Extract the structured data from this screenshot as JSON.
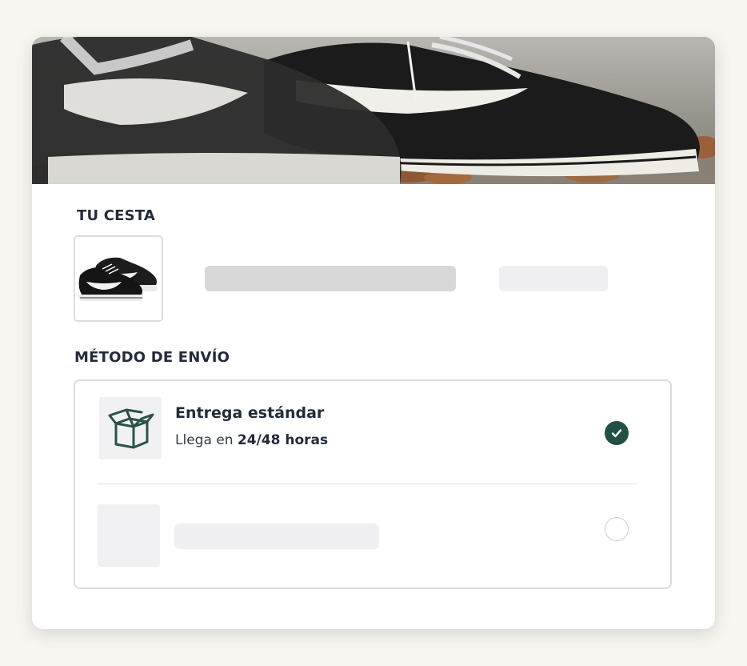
{
  "hero": {
    "image": "black-and-white-sneakers-photo"
  },
  "cart": {
    "title": "TU CESTA",
    "product_image": "black-sneaker-thumbnail"
  },
  "shipping": {
    "title": "MÉTODO DE ENVÍO",
    "options": [
      {
        "icon": "box-icon",
        "title": "Entrega estándar",
        "subtitle_prefix": "Llega en ",
        "subtitle_bold": "24/48 horas",
        "selected": true
      },
      {
        "selected": false
      }
    ]
  },
  "colors": {
    "accent": "#234f44",
    "skeleton_dark": "#d8d8d8",
    "skeleton_light": "#f0f0f2",
    "page_background": "#f8f6f1"
  }
}
